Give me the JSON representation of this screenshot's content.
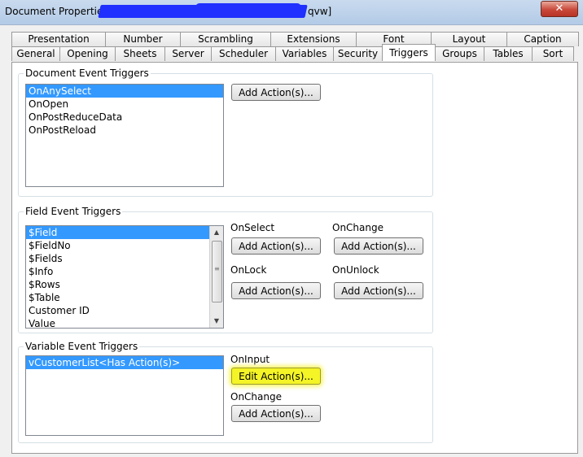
{
  "window": {
    "title": "Document Properties [",
    "title_suffix": "qvw]",
    "close_label": "✕"
  },
  "tabs": {
    "row1": [
      "Presentation",
      "Number",
      "Scrambling",
      "Extensions",
      "Font",
      "Layout",
      "Caption"
    ],
    "row2": [
      "General",
      "Opening",
      "Sheets",
      "Server",
      "Scheduler",
      "Variables",
      "Security",
      "Triggers",
      "Groups",
      "Tables",
      "Sort"
    ],
    "active": "Triggers"
  },
  "document_triggers": {
    "legend": "Document Event Triggers",
    "items": [
      "OnAnySelect",
      "OnOpen",
      "OnPostReduceData",
      "OnPostReload"
    ],
    "selected_index": 0,
    "add_button": "Add Action(s)..."
  },
  "field_triggers": {
    "legend": "Field Event Triggers",
    "items": [
      "$Field",
      "$FieldNo",
      "$Fields",
      "$Info",
      "$Rows",
      "$Table",
      "Customer ID",
      "Value"
    ],
    "selected_index": 0,
    "on_select_label": "OnSelect",
    "on_change_label": "OnChange",
    "on_lock_label": "OnLock",
    "on_unlock_label": "OnUnlock",
    "on_select_button": "Add Action(s)...",
    "on_change_button": "Add Action(s)...",
    "on_lock_button": "Add Action(s)...",
    "on_unlock_button": "Add Action(s)..."
  },
  "variable_triggers": {
    "legend": "Variable Event Triggers",
    "items": [
      "vCustomerList<Has Action(s)>"
    ],
    "selected_index": 0,
    "on_input_label": "OnInput",
    "on_input_button": "Edit Action(s)...",
    "on_change_label": "OnChange",
    "on_change_button": "Add Action(s)..."
  },
  "colors": {
    "selection": "#3399ff",
    "highlight": "#f4f427",
    "redaction": "#1f30ff"
  }
}
